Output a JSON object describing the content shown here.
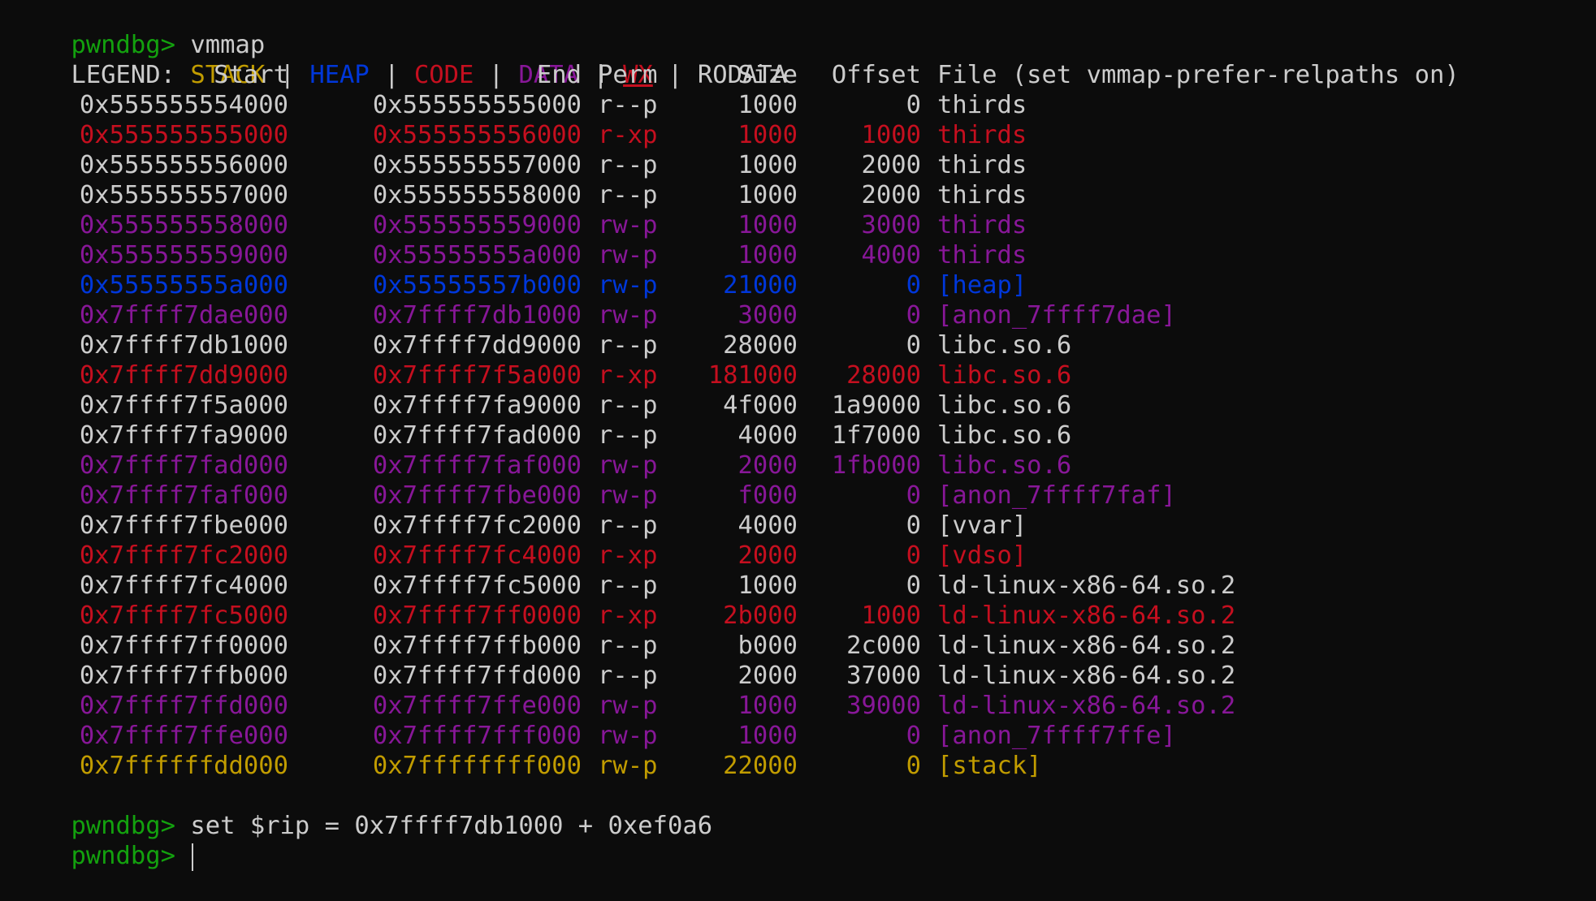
{
  "colors": {
    "prompt": "#13a10e",
    "default": "#cccccc",
    "stack": "#c19c00",
    "heap": "#0037da",
    "code": "#c50f1f",
    "data": "#881798",
    "wx": "#c50f1f",
    "rodata": "#cccccc",
    "background": "#0c0c0c"
  },
  "prompt": "pwndbg>",
  "command_1": "vmmap",
  "legend": {
    "label": "LEGEND:",
    "sep": "|",
    "stack": "STACK",
    "heap": "HEAP",
    "code": "CODE",
    "data": "DATA",
    "wx": "WX",
    "rodata": "RODATA"
  },
  "header": {
    "start": "Start",
    "end": "End",
    "perm": "Perm",
    "size": "Size",
    "offset": "Offset",
    "file": "File (set vmmap-prefer-relpaths on)"
  },
  "rows": [
    {
      "start": "0x555555554000",
      "end": "0x555555555000",
      "perm": "r--p",
      "size": "1000",
      "offset": "0",
      "file": "thirds",
      "kind": "rodata"
    },
    {
      "start": "0x555555555000",
      "end": "0x555555556000",
      "perm": "r-xp",
      "size": "1000",
      "offset": "1000",
      "file": "thirds",
      "kind": "code"
    },
    {
      "start": "0x555555556000",
      "end": "0x555555557000",
      "perm": "r--p",
      "size": "1000",
      "offset": "2000",
      "file": "thirds",
      "kind": "rodata"
    },
    {
      "start": "0x555555557000",
      "end": "0x555555558000",
      "perm": "r--p",
      "size": "1000",
      "offset": "2000",
      "file": "thirds",
      "kind": "rodata"
    },
    {
      "start": "0x555555558000",
      "end": "0x555555559000",
      "perm": "rw-p",
      "size": "1000",
      "offset": "3000",
      "file": "thirds",
      "kind": "data"
    },
    {
      "start": "0x555555559000",
      "end": "0x55555555a000",
      "perm": "rw-p",
      "size": "1000",
      "offset": "4000",
      "file": "thirds",
      "kind": "data"
    },
    {
      "start": "0x55555555a000",
      "end": "0x55555557b000",
      "perm": "rw-p",
      "size": "21000",
      "offset": "0",
      "file": "[heap]",
      "kind": "heap"
    },
    {
      "start": "0x7ffff7dae000",
      "end": "0x7ffff7db1000",
      "perm": "rw-p",
      "size": "3000",
      "offset": "0",
      "file": "[anon_7ffff7dae]",
      "kind": "data"
    },
    {
      "start": "0x7ffff7db1000",
      "end": "0x7ffff7dd9000",
      "perm": "r--p",
      "size": "28000",
      "offset": "0",
      "file": "libc.so.6",
      "kind": "rodata"
    },
    {
      "start": "0x7ffff7dd9000",
      "end": "0x7ffff7f5a000",
      "perm": "r-xp",
      "size": "181000",
      "offset": "28000",
      "file": "libc.so.6",
      "kind": "code"
    },
    {
      "start": "0x7ffff7f5a000",
      "end": "0x7ffff7fa9000",
      "perm": "r--p",
      "size": "4f000",
      "offset": "1a9000",
      "file": "libc.so.6",
      "kind": "rodata"
    },
    {
      "start": "0x7ffff7fa9000",
      "end": "0x7ffff7fad000",
      "perm": "r--p",
      "size": "4000",
      "offset": "1f7000",
      "file": "libc.so.6",
      "kind": "rodata"
    },
    {
      "start": "0x7ffff7fad000",
      "end": "0x7ffff7faf000",
      "perm": "rw-p",
      "size": "2000",
      "offset": "1fb000",
      "file": "libc.so.6",
      "kind": "data"
    },
    {
      "start": "0x7ffff7faf000",
      "end": "0x7ffff7fbe000",
      "perm": "rw-p",
      "size": "f000",
      "offset": "0",
      "file": "[anon_7ffff7faf]",
      "kind": "data"
    },
    {
      "start": "0x7ffff7fbe000",
      "end": "0x7ffff7fc2000",
      "perm": "r--p",
      "size": "4000",
      "offset": "0",
      "file": "[vvar]",
      "kind": "rodata"
    },
    {
      "start": "0x7ffff7fc2000",
      "end": "0x7ffff7fc4000",
      "perm": "r-xp",
      "size": "2000",
      "offset": "0",
      "file": "[vdso]",
      "kind": "code"
    },
    {
      "start": "0x7ffff7fc4000",
      "end": "0x7ffff7fc5000",
      "perm": "r--p",
      "size": "1000",
      "offset": "0",
      "file": "ld-linux-x86-64.so.2",
      "kind": "rodata"
    },
    {
      "start": "0x7ffff7fc5000",
      "end": "0x7ffff7ff0000",
      "perm": "r-xp",
      "size": "2b000",
      "offset": "1000",
      "file": "ld-linux-x86-64.so.2",
      "kind": "code"
    },
    {
      "start": "0x7ffff7ff0000",
      "end": "0x7ffff7ffb000",
      "perm": "r--p",
      "size": "b000",
      "offset": "2c000",
      "file": "ld-linux-x86-64.so.2",
      "kind": "rodata"
    },
    {
      "start": "0x7ffff7ffb000",
      "end": "0x7ffff7ffd000",
      "perm": "r--p",
      "size": "2000",
      "offset": "37000",
      "file": "ld-linux-x86-64.so.2",
      "kind": "rodata"
    },
    {
      "start": "0x7ffff7ffd000",
      "end": "0x7ffff7ffe000",
      "perm": "rw-p",
      "size": "1000",
      "offset": "39000",
      "file": "ld-linux-x86-64.so.2",
      "kind": "data"
    },
    {
      "start": "0x7ffff7ffe000",
      "end": "0x7ffff7fff000",
      "perm": "rw-p",
      "size": "1000",
      "offset": "0",
      "file": "[anon_7ffff7ffe]",
      "kind": "data"
    },
    {
      "start": "0x7ffffffdd000",
      "end": "0x7ffffffff000",
      "perm": "rw-p",
      "size": "22000",
      "offset": "0",
      "file": "[stack]",
      "kind": "stack"
    }
  ],
  "command_2": "set $rip = 0x7ffff7db1000 + 0xef0a6",
  "command_3": ""
}
